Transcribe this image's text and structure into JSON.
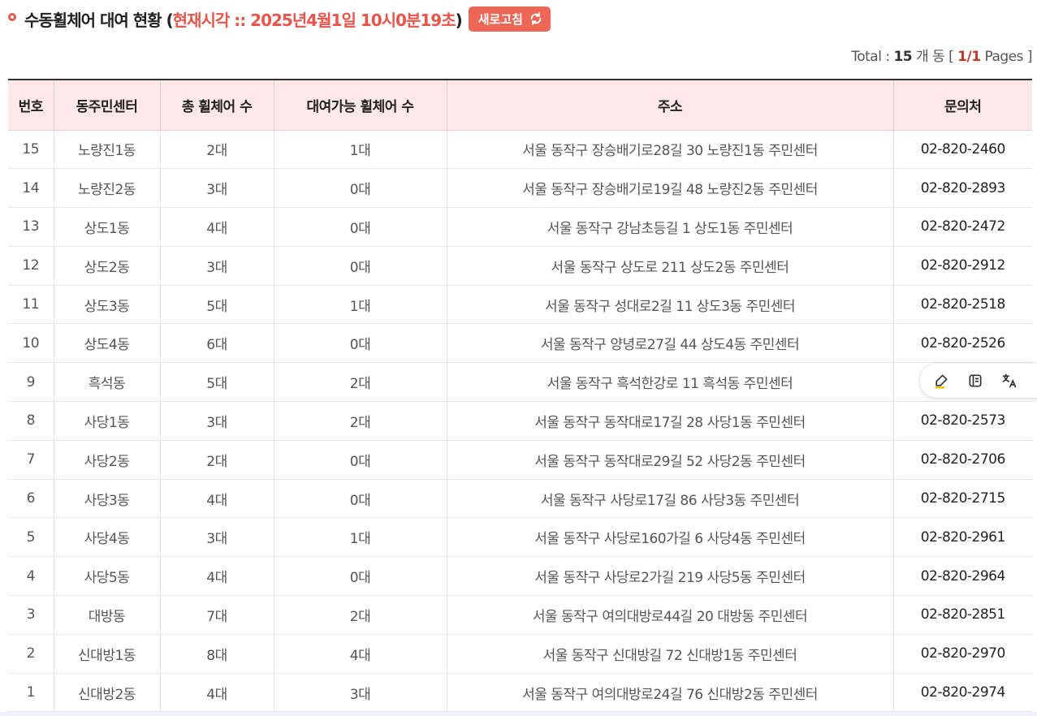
{
  "header": {
    "title_main": "수동휠체어 대여 현황 (",
    "title_time": "현재시각 :: 2025년4월1일 10시0분19초",
    "title_close": ")",
    "refresh_label": "새로고침"
  },
  "summary": {
    "prefix": "Total : ",
    "count": "15",
    "unit": " 개 동 [ ",
    "page": "1/1",
    "suffix": " Pages ]"
  },
  "table": {
    "headers": [
      "번호",
      "동주민센터",
      "총 휠체어 수",
      "대여가능 휠체어 수",
      "주소",
      "문의처"
    ],
    "rows": [
      [
        "15",
        "노량진1동",
        "2대",
        "1대",
        "서울 동작구 장승배기로28길 30 노량진1동 주민센터",
        "02-820-2460"
      ],
      [
        "14",
        "노량진2동",
        "3대",
        "0대",
        "서울 동작구 장승배기로19길 48 노량진2동 주민센터",
        "02-820-2893"
      ],
      [
        "13",
        "상도1동",
        "4대",
        "0대",
        "서울 동작구 강남초등길 1 상도1동 주민센터",
        "02-820-2472"
      ],
      [
        "12",
        "상도2동",
        "3대",
        "0대",
        "서울 동작구 상도로 211 상도2동 주민센터",
        "02-820-2912"
      ],
      [
        "11",
        "상도3동",
        "5대",
        "1대",
        "서울 동작구 성대로2길 11 상도3동 주민센터",
        "02-820-2518"
      ],
      [
        "10",
        "상도4동",
        "6대",
        "0대",
        "서울 동작구 양녕로27길 44 상도4동 주민센터",
        "02-820-2526"
      ],
      [
        "9",
        "흑석동",
        "5대",
        "2대",
        "서울 동작구 흑석한강로 11 흑석동 주민센터",
        ""
      ],
      [
        "8",
        "사당1동",
        "3대",
        "2대",
        "서울 동작구 동작대로17길 28 사당1동 주민센터",
        "02-820-2573"
      ],
      [
        "7",
        "사당2동",
        "2대",
        "0대",
        "서울 동작구 동작대로29길 52 사당2동 주민센터",
        "02-820-2706"
      ],
      [
        "6",
        "사당3동",
        "4대",
        "0대",
        "서울 동작구 사당로17길 86 사당3동 주민센터",
        "02-820-2715"
      ],
      [
        "5",
        "사당4동",
        "3대",
        "1대",
        "서울 동작구 사당로160가길 6 사당4동 주민센터",
        "02-820-2961"
      ],
      [
        "4",
        "사당5동",
        "4대",
        "0대",
        "서울 동작구 사당로2가길 219 사당5동 주민센터",
        "02-820-2964"
      ],
      [
        "3",
        "대방동",
        "7대",
        "2대",
        "서울 동작구 여의대방로44길 20 대방동 주민센터",
        "02-820-2851"
      ],
      [
        "2",
        "신대방1동",
        "8대",
        "4대",
        "서울 동작구 신대방길 72 신대방1동 주민센터",
        "02-820-2970"
      ],
      [
        "1",
        "신대방2동",
        "4대",
        "3대",
        "서울 동작구 여의대방로24길 76 신대방2동 주민센터",
        "02-820-2974"
      ]
    ]
  },
  "floating_toolbar": {
    "icons": [
      "highlighter-icon",
      "notes-icon",
      "translate-icon"
    ]
  },
  "colors": {
    "accent": "#e8554a",
    "button": "#ee6655",
    "header_bg": "#fce8e6"
  }
}
